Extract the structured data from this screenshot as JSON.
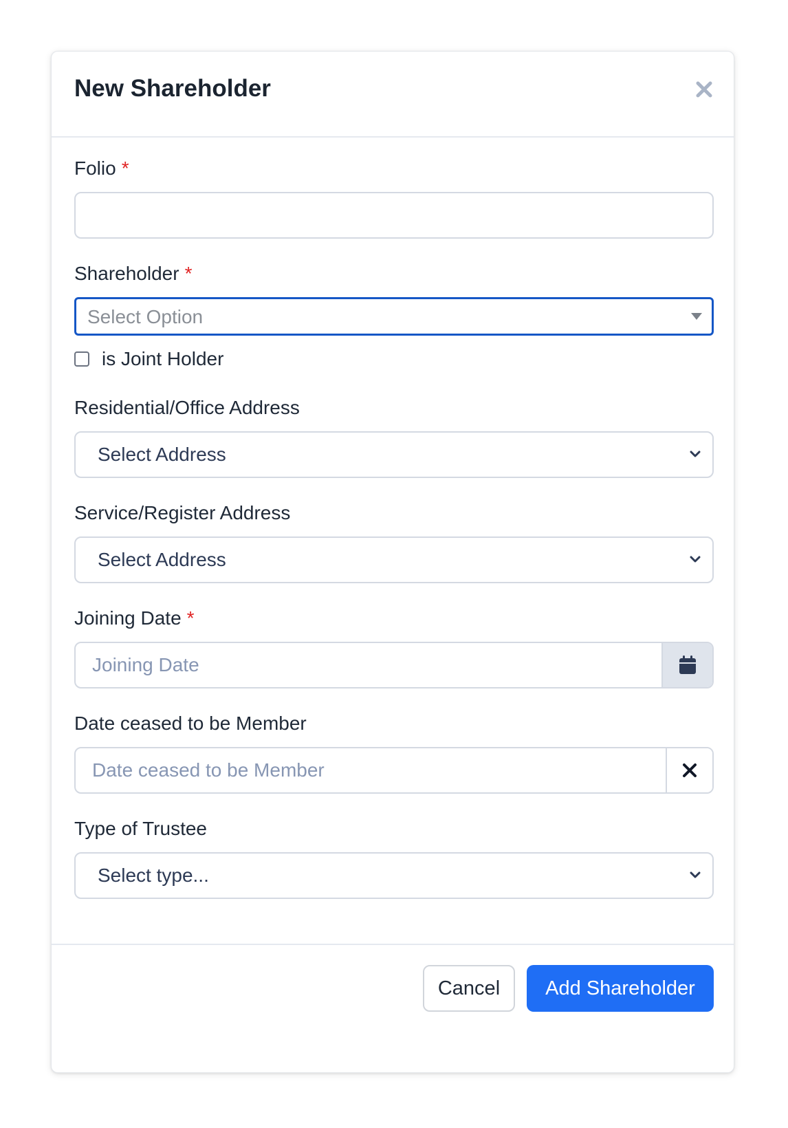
{
  "modal": {
    "title": "New Shareholder"
  },
  "fields": {
    "folio": {
      "label": "Folio",
      "required_mark": "*",
      "value": ""
    },
    "shareholder": {
      "label": "Shareholder",
      "required_mark": "*",
      "placeholder": "Select Option"
    },
    "joint_holder": {
      "label": "is Joint Holder",
      "checked": false
    },
    "residential_address": {
      "label": "Residential/Office Address",
      "selected": "Select Address"
    },
    "service_address": {
      "label": "Service/Register Address",
      "selected": "Select Address"
    },
    "joining_date": {
      "label": "Joining Date",
      "required_mark": "*",
      "placeholder": "Joining Date"
    },
    "date_ceased": {
      "label": "Date ceased to be Member",
      "placeholder": "Date ceased to be Member"
    },
    "trustee_type": {
      "label": "Type of Trustee",
      "selected": "Select type..."
    }
  },
  "footer": {
    "cancel_label": "Cancel",
    "submit_label": "Add Shareholder"
  },
  "icons": {
    "close": "close-icon",
    "dropdown": "caret-down-icon",
    "chevron": "chevron-down-icon",
    "calendar": "calendar-icon",
    "clear": "clear-icon"
  },
  "colors": {
    "primary": "#1f6ef5",
    "focus_border": "#1557c6",
    "required": "#e02424",
    "placeholder": "#8796b3"
  }
}
